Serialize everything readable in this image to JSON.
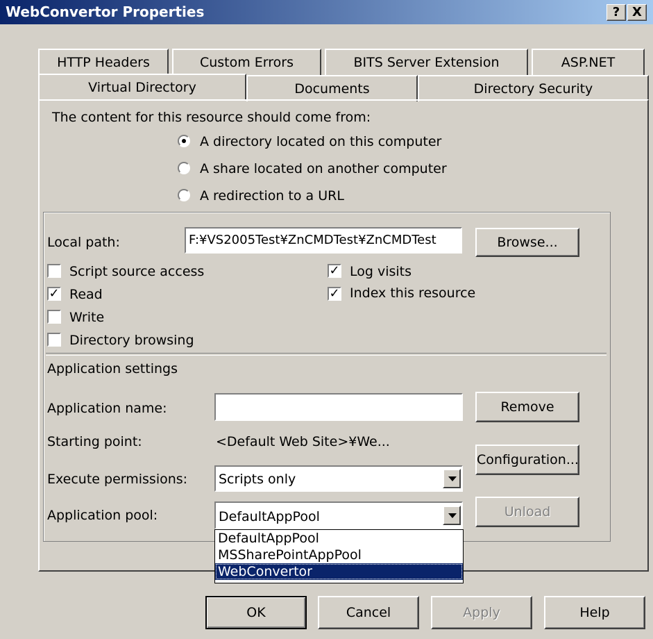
{
  "window": {
    "title": "WebConvertor Properties",
    "help_btn": "?",
    "close_btn": "X"
  },
  "tabs_row1": [
    "HTTP Headers",
    "Custom Errors",
    "BITS Server Extension",
    "ASP.NET"
  ],
  "tabs_row2": [
    "Virtual Directory",
    "Documents",
    "Directory Security"
  ],
  "content_source": {
    "prompt": "The content for this resource should come from:",
    "options": [
      "A directory located on this computer",
      "A share located on another computer",
      "A redirection to a URL"
    ],
    "selected": 0
  },
  "local_path": {
    "label": "Local path:",
    "value": "F:¥VS2005Test¥ZnCMDTest¥ZnCMDTest",
    "browse": "Browse..."
  },
  "permissions": {
    "script_source_access": {
      "label": "Script source access",
      "checked": false
    },
    "read": {
      "label": "Read",
      "checked": true
    },
    "write": {
      "label": "Write",
      "checked": false
    },
    "directory_browsing": {
      "label": "Directory browsing",
      "checked": false
    },
    "log_visits": {
      "label": "Log visits",
      "checked": true
    },
    "index_resource": {
      "label": "Index this resource",
      "checked": true
    }
  },
  "app_settings": {
    "heading": "Application settings",
    "name_label": "Application name:",
    "name_value": "",
    "remove": "Remove",
    "starting_point_label": "Starting point:",
    "starting_point_value": "<Default Web Site>¥We...",
    "configuration": "Configuration...",
    "exec_label": "Execute permissions:",
    "exec_value": "Scripts only",
    "pool_label": "Application pool:",
    "pool_value": "DefaultAppPool",
    "unload": "Unload",
    "pool_options": [
      "DefaultAppPool",
      "MSSharePointAppPool",
      "WebConvertor"
    ],
    "pool_highlighted": 2
  },
  "footer": {
    "ok": "OK",
    "cancel": "Cancel",
    "apply": "Apply",
    "help": "Help"
  },
  "colors": {
    "title_start": "#0a246a",
    "title_end": "#a6caf0",
    "face": "#d4d0c8",
    "highlight": "#0a246a"
  }
}
